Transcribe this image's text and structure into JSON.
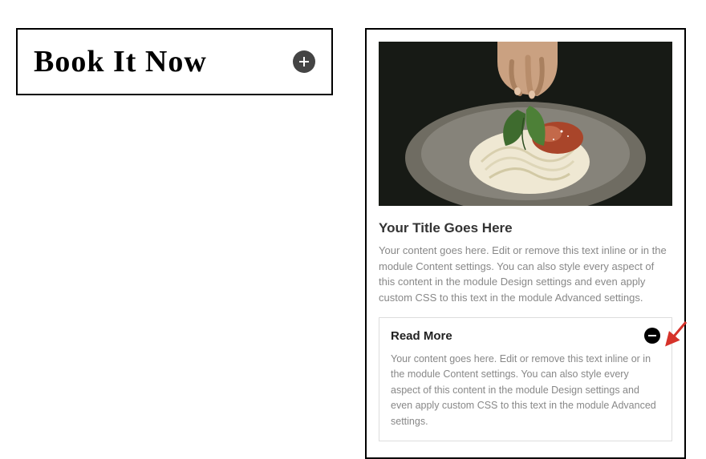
{
  "left": {
    "title": "Book It Now"
  },
  "right": {
    "title": "Your Title Goes Here",
    "desc": "Your content goes here. Edit or remove this text inline or in the module Content settings. You can also style every aspect of this content in the module Design settings and even apply custom CSS to this text in the module Advanced settings.",
    "accordion": {
      "label": "Read More",
      "body": "Your content goes here. Edit or remove this text inline or in the module Content settings. You can also style every aspect of this content in the module Design settings and even apply custom CSS to this text in the module Advanced settings."
    }
  },
  "icons": {
    "plus": "plus",
    "minus": "minus"
  },
  "annotation": {
    "arrow_color": "#d6322a"
  }
}
